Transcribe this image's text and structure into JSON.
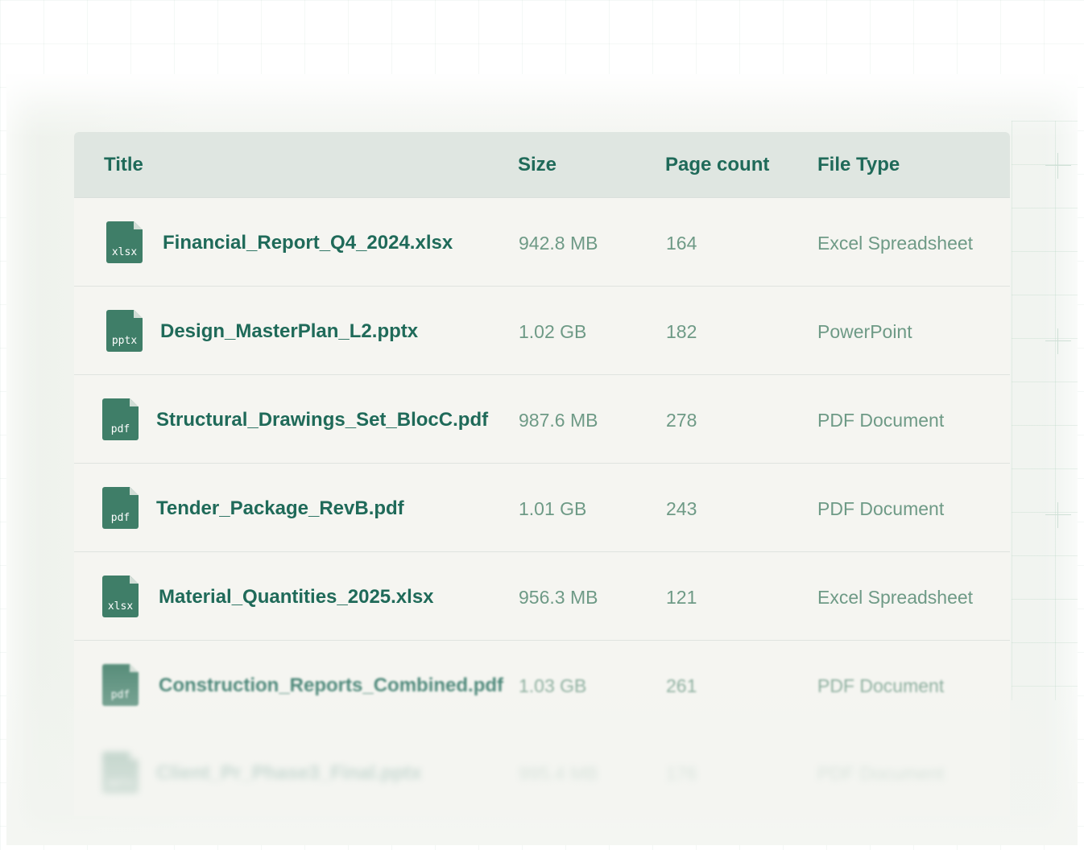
{
  "table": {
    "columns": {
      "title": "Title",
      "size": "Size",
      "page_count": "Page count",
      "file_type": "File Type"
    },
    "rows": [
      {
        "icon": "xlsx",
        "title": "Financial_Report_Q4_2024.xlsx",
        "size": "942.8 MB",
        "pages": "164",
        "type": "Excel Spreadsheet"
      },
      {
        "icon": "pptx",
        "title": "Design_MasterPlan_L2.pptx",
        "size": "1.02 GB",
        "pages": "182",
        "type": "PowerPoint"
      },
      {
        "icon": "pdf",
        "title": "Structural_Drawings_Set_BlocC.pdf",
        "size": "987.6 MB",
        "pages": "278",
        "type": "PDF Document"
      },
      {
        "icon": "pdf",
        "title": "Tender_Package_RevB.pdf",
        "size": "1.01 GB",
        "pages": "243",
        "type": "PDF Document"
      },
      {
        "icon": "xlsx",
        "title": "Material_Quantities_2025.xlsx",
        "size": "956.3 MB",
        "pages": "121",
        "type": "Excel Spreadsheet"
      },
      {
        "icon": "pdf",
        "title": "Construction_Reports_Combined.pdf",
        "size": "1.03 GB",
        "pages": "261",
        "type": "PDF Document"
      },
      {
        "icon": "pptx",
        "title": "Client_Pr_Phase3_Final.pptx",
        "size": "995.4 MB",
        "pages": "176",
        "type": "PDF Document"
      }
    ]
  },
  "colors": {
    "accent": "#1f6a59",
    "muted_text": "#6e9a86",
    "header_bg": "#dfe6e1",
    "icon_bg": "#3f7e68"
  }
}
